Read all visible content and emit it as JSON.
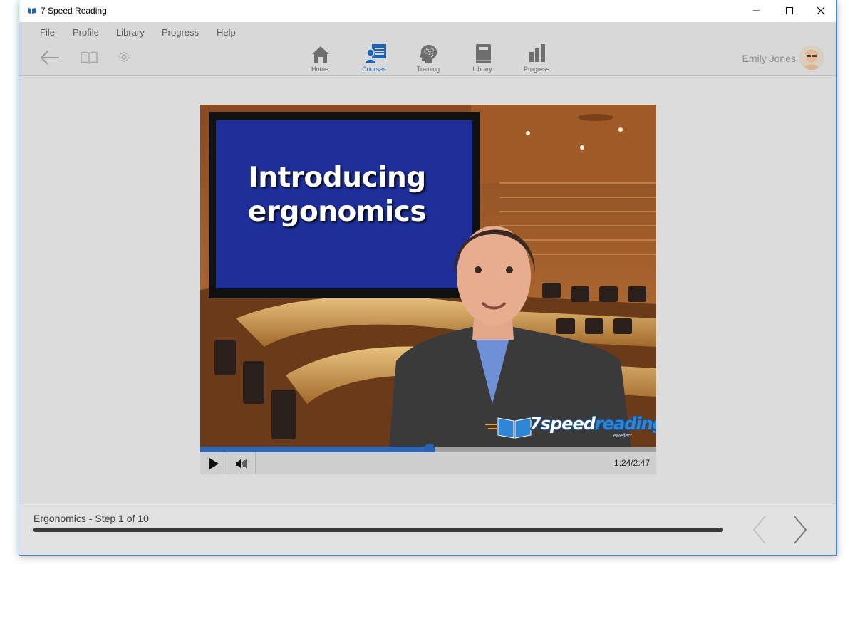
{
  "window": {
    "title": "7 Speed Reading"
  },
  "menu": [
    "File",
    "Profile",
    "Library",
    "Progress",
    "Help"
  ],
  "toolbar": {
    "nav": [
      {
        "label": "Home",
        "icon": "home-icon",
        "active": false
      },
      {
        "label": "Courses",
        "icon": "courses-icon",
        "active": true
      },
      {
        "label": "Training",
        "icon": "training-icon",
        "active": false
      },
      {
        "label": "Library",
        "icon": "library-icon",
        "active": false
      },
      {
        "label": "Progress",
        "icon": "progress-icon",
        "active": false
      }
    ],
    "user_name": "Emily Jones"
  },
  "video": {
    "title_line1": "Introducing",
    "title_line2": "ergonomics",
    "logo_digit": "7",
    "logo_word1": "speed",
    "logo_word2": "reading",
    "logo_tm": "™",
    "logo_sub": "eReflect",
    "time": "1:24/2:47",
    "played_fraction": 0.503
  },
  "lesson": {
    "step_text": "Ergonomics - Step 1 of 10",
    "progress_fraction": 1.0
  },
  "colors": {
    "accent": "#2f67b5",
    "titlebar": "#ffffff",
    "toolbar_bg": "#d8d8d8",
    "content_bg": "#dcdcdc",
    "active_nav": "#1a64b8"
  }
}
